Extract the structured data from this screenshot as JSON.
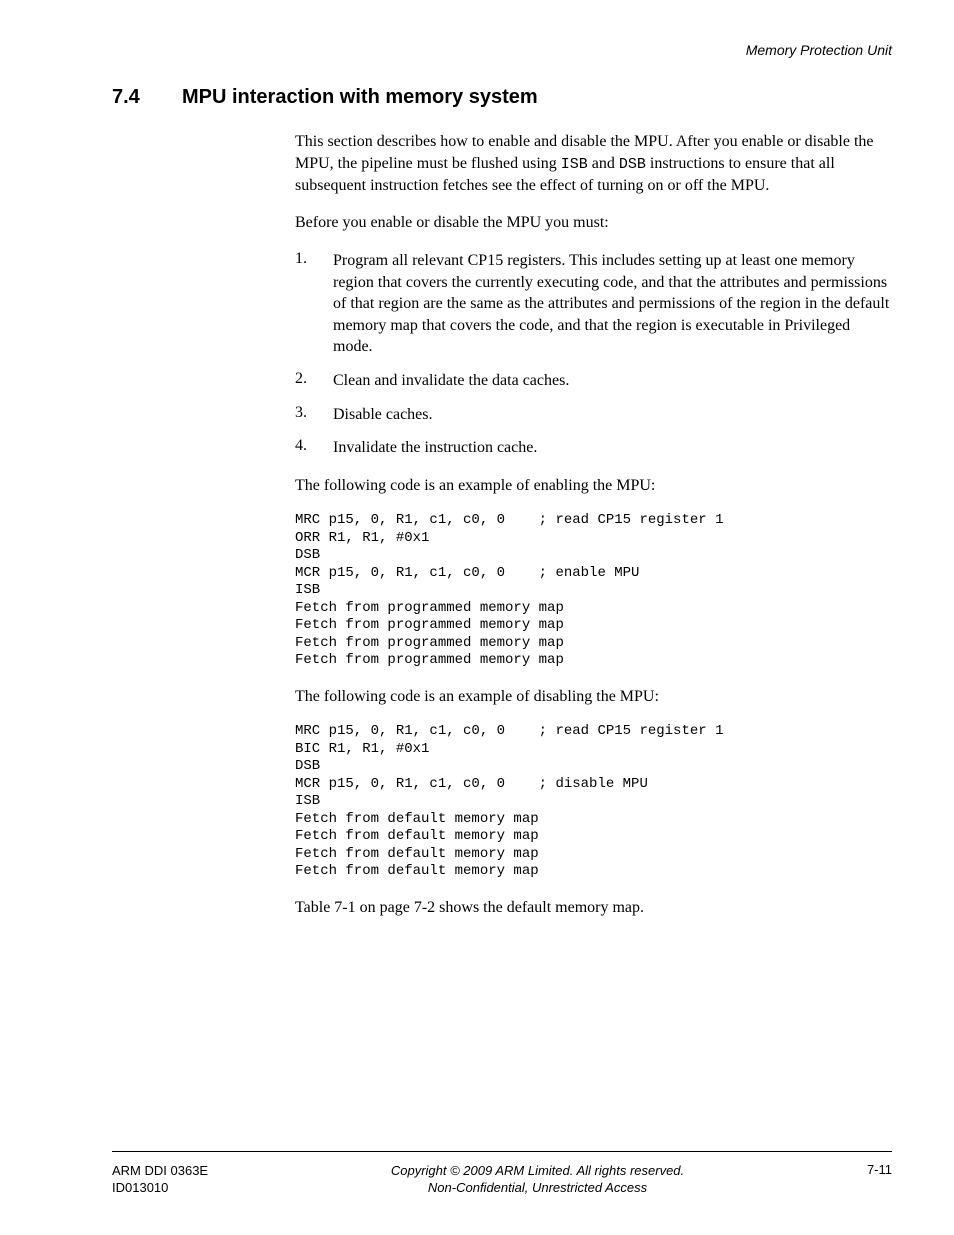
{
  "running_header": "Memory Protection Unit",
  "section": {
    "number": "7.4",
    "title": "MPU interaction with memory system"
  },
  "p1_a": "This section describes how to enable and disable the MPU. After you enable or disable the MPU, the pipeline must be flushed using ",
  "p1_isb": "ISB",
  "p1_b": " and ",
  "p1_dsb": "DSB",
  "p1_c": " instructions to ensure that all subsequent instruction fetches see the effect of turning on or off the MPU.",
  "p2": "Before you enable or disable the MPU you must:",
  "steps": [
    "Program all relevant CP15 registers. This includes setting up at least one memory region that covers the currently executing code, and that the attributes and permissions of that region are the same as the attributes and permissions of the region in the default memory map that covers the code, and that the region is executable in Privileged mode.",
    "Clean and invalidate the data caches.",
    "Disable caches.",
    "Invalidate the instruction cache."
  ],
  "p3": "The following code is an example of enabling the MPU:",
  "code1": "MRC p15, 0, R1, c1, c0, 0    ; read CP15 register 1\nORR R1, R1, #0x1\nDSB\nMCR p15, 0, R1, c1, c0, 0    ; enable MPU\nISB\nFetch from programmed memory map\nFetch from programmed memory map\nFetch from programmed memory map\nFetch from programmed memory map",
  "p4": "The following code is an example of disabling the MPU:",
  "code2": "MRC p15, 0, R1, c1, c0, 0    ; read CP15 register 1\nBIC R1, R1, #0x1\nDSB\nMCR p15, 0, R1, c1, c0, 0    ; disable MPU\nISB\nFetch from default memory map\nFetch from default memory map\nFetch from default memory map\nFetch from default memory map",
  "p5": "Table 7-1 on page 7-2 shows the default memory map.",
  "footer": {
    "left1": "ARM DDI 0363E",
    "left2": "ID013010",
    "center1": "Copyright © 2009 ARM Limited. All rights reserved.",
    "center2": "Non-Confidential, Unrestricted Access",
    "right": "7-11"
  }
}
